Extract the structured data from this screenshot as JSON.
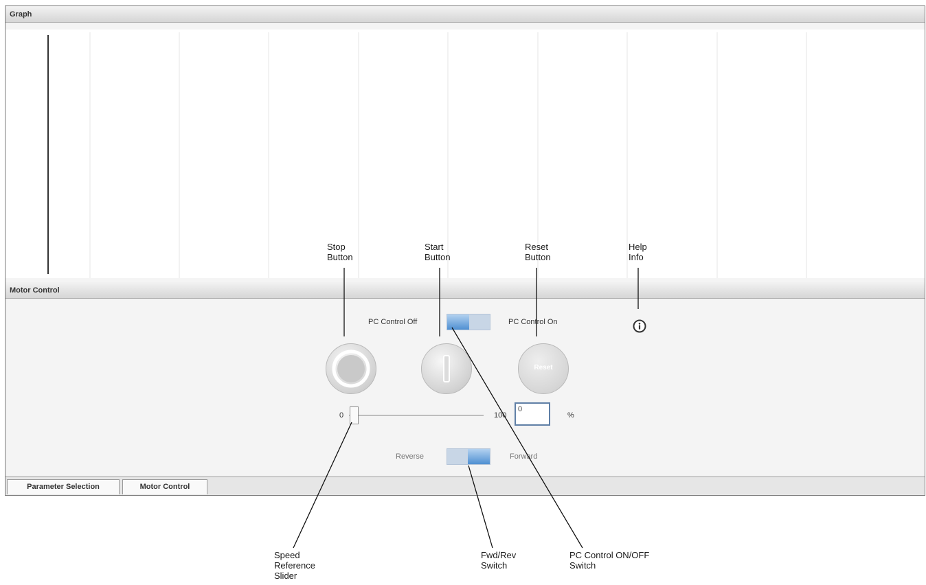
{
  "graph_panel": {
    "title": "Graph"
  },
  "motor_panel": {
    "title": "Motor Control",
    "pc_control_off_label": "PC Control Off",
    "pc_control_on_label": "PC Control On",
    "reset_label": "Reset",
    "slider_min_label": "0",
    "slider_max_label": "100",
    "speed_value": "0",
    "percent_label": "%",
    "reverse_label": "Reverse",
    "forward_label": "Forward"
  },
  "tabs": [
    {
      "label": "Parameter Selection"
    },
    {
      "label": "Motor Control"
    }
  ],
  "callouts": {
    "stop": [
      "Stop",
      "Button"
    ],
    "start": [
      "Start",
      "Button"
    ],
    "reset": [
      "Reset",
      "Button"
    ],
    "help": [
      "Help",
      "Info"
    ],
    "speed": [
      "Speed",
      "Reference",
      "Slider"
    ],
    "fwdrev": [
      "Fwd/Rev",
      "Switch"
    ],
    "pccontrol": [
      "PC Control ON/OFF",
      "Switch"
    ]
  },
  "icons": {
    "help": "info-icon",
    "stop": "stop-ring-icon",
    "start": "start-bar-icon"
  }
}
